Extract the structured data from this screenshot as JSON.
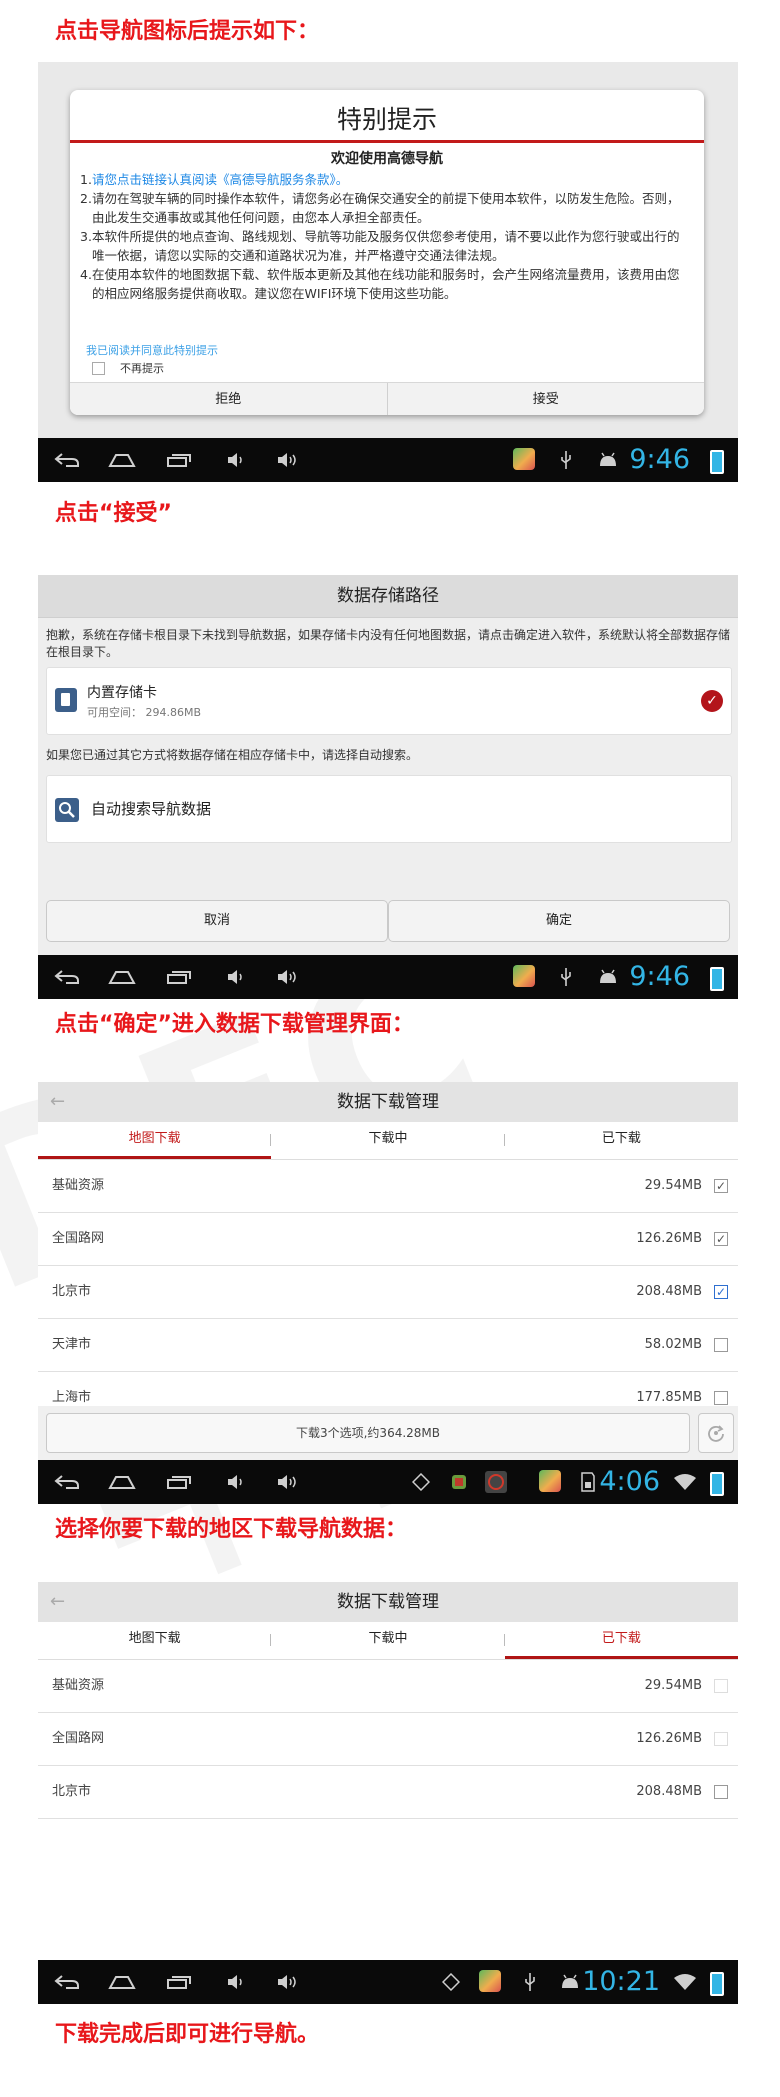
{
  "captions": {
    "c1": "点击导航图标后提示如下：",
    "c2": "点击“接受”",
    "c3": "点击“确定”进入数据下载管理界面：",
    "c4": "选择你要下载的地区下载导航数据：",
    "c5": "下载完成后即可进行导航。"
  },
  "watermark": "DEC中恒",
  "dialog": {
    "title": "特别提示",
    "subtitle": "欢迎使用高德导航",
    "terms": [
      {
        "num": "1.",
        "text": "请您点击链接认真阅读《高德导航服务条款》。"
      },
      {
        "num": "2.",
        "text": "请勿在驾驶车辆的同时操作本软件，请您务必在确保交通安全的前提下使用本软件，以防发生危险。否则，由此发生交通事故或其他任何问题，由您本人承担全部责任。"
      },
      {
        "num": "3.",
        "text": "本软件所提供的地点查询、路线规划、导航等功能及服务仅供您参考使用，请不要以此作为您行驶或出行的唯一依据，请您以实际的交通和道路状况为准，并严格遵守交通法律法规。"
      },
      {
        "num": "4.",
        "text": "在使用本软件的地图数据下载、软件版本更新及其他在线功能和服务时，会产生网络流量费用，该费用由您的相应网络服务提供商收取。建议您在WIFI环境下使用这些功能。"
      }
    ],
    "ack_link": "我已阅读并同意此特别提示",
    "no_remind": "不再提示",
    "reject": "拒绝",
    "accept": "接受"
  },
  "storage": {
    "title": "数据存储路径",
    "notice": "抱歉，系统在存储卡根目录下未找到导航数据，如果存储卡内没有任何地图数据，请点击确定进入软件，系统默认将全部数据存储在根目录下。",
    "card_name": "内置存储卡",
    "card_space": "可用空间： 294.86MB",
    "auto_hint": "如果您已通过其它方式将数据存储在相应存储卡中，请选择自动搜索。",
    "auto_search": "自动搜索导航数据",
    "cancel": "取消",
    "confirm": "确定"
  },
  "download1": {
    "title": "数据下载管理",
    "tabs": [
      "地图下载",
      "下载中",
      "已下载"
    ],
    "rows": [
      {
        "name": "基础资源",
        "size": "29.54MB",
        "state": "checked"
      },
      {
        "name": "全国路网",
        "size": "126.26MB",
        "state": "checked"
      },
      {
        "name": "北京市",
        "size": "208.48MB",
        "state": "checked-blue"
      },
      {
        "name": "天津市",
        "size": "58.02MB",
        "state": "unchecked"
      },
      {
        "name": "上海市",
        "size": "177.85MB",
        "state": "unchecked"
      }
    ],
    "download_button": "下载3个选项,约364.28MB"
  },
  "download2": {
    "title": "数据下载管理",
    "tabs": [
      "地图下载",
      "下载中",
      "已下载"
    ],
    "rows": [
      {
        "name": "基础资源",
        "size": "29.54MB"
      },
      {
        "name": "全国路网",
        "size": "126.26MB"
      },
      {
        "name": "北京市",
        "size": "208.48MB"
      }
    ]
  },
  "clocks": [
    "9:46",
    "9:46",
    "4:06",
    "10:21"
  ],
  "colors": {
    "caption_red": "#e8171b",
    "accent_red": "#c21a1a",
    "clock_blue": "#33b5e5",
    "link_blue": "#1e88e5"
  }
}
